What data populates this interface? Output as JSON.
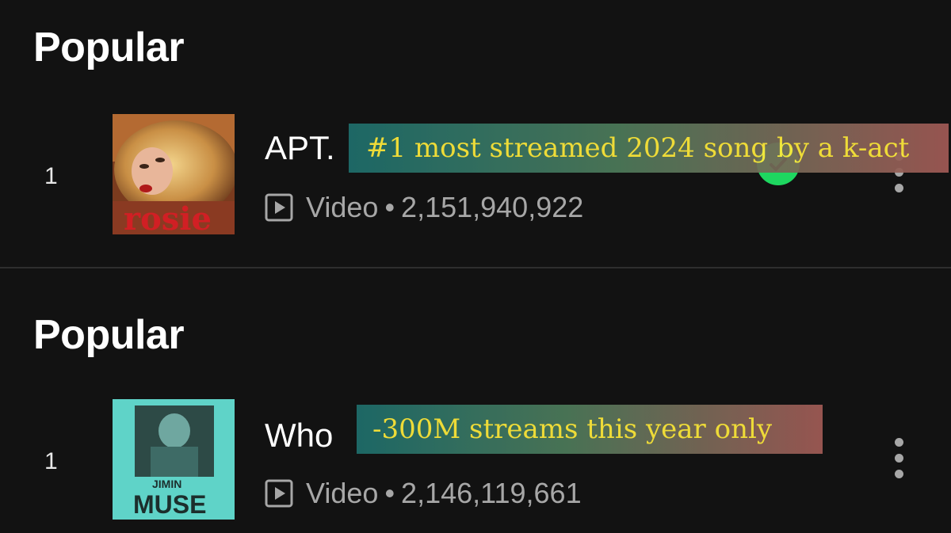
{
  "entries": [
    {
      "heading": "Popular",
      "rank": "1",
      "title": "APT.",
      "type_label": "Video",
      "separator": "•",
      "count": "2,151,940,922",
      "annotation": "#1 most streamed 2024 song by a k-act",
      "art_text": "rosie",
      "saved": true
    },
    {
      "heading": "Popular",
      "rank": "1",
      "title": "Who",
      "type_label": "Video",
      "separator": "•",
      "count": "2,146,119,661",
      "annotation": "-300M streams this year only",
      "art_text_top": "JIMIN",
      "art_text_bottom": "MUSE",
      "saved": false
    }
  ],
  "colors": {
    "background": "#121212",
    "accent_green": "#1ed760",
    "annotation_text": "#ffeb3b",
    "muted_text": "#a7a7a7"
  },
  "icons": {
    "video": "video-play-icon",
    "saved": "check-circle-icon",
    "more": "more-vertical-icon"
  }
}
